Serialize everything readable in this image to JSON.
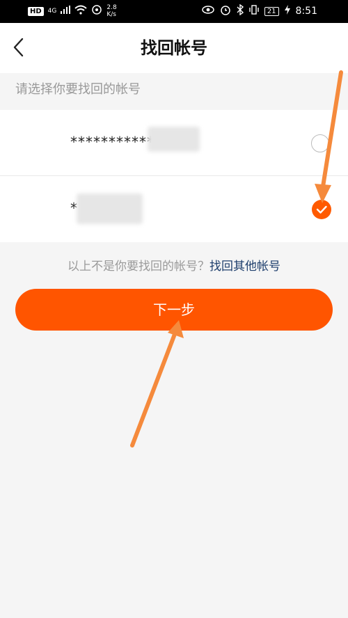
{
  "status_bar": {
    "hd": "HD",
    "network": "4G",
    "speed_value": "2.8",
    "speed_unit": "K/s",
    "battery": "21",
    "time": "8:51"
  },
  "navbar": {
    "title": "找回帐号"
  },
  "section": {
    "label": "请选择你要找回的帐号"
  },
  "accounts": [
    {
      "masked_text": "************:",
      "selected": false
    },
    {
      "masked_text": "*",
      "selected": true
    }
  ],
  "hint": {
    "text": "以上不是你要找回的帐号？",
    "link": "找回其他帐号"
  },
  "next_button": {
    "label": "下一步"
  },
  "colors": {
    "accent": "#ff5500",
    "link": "#1f3f6d",
    "annotation_arrow": "#f58a3c"
  }
}
